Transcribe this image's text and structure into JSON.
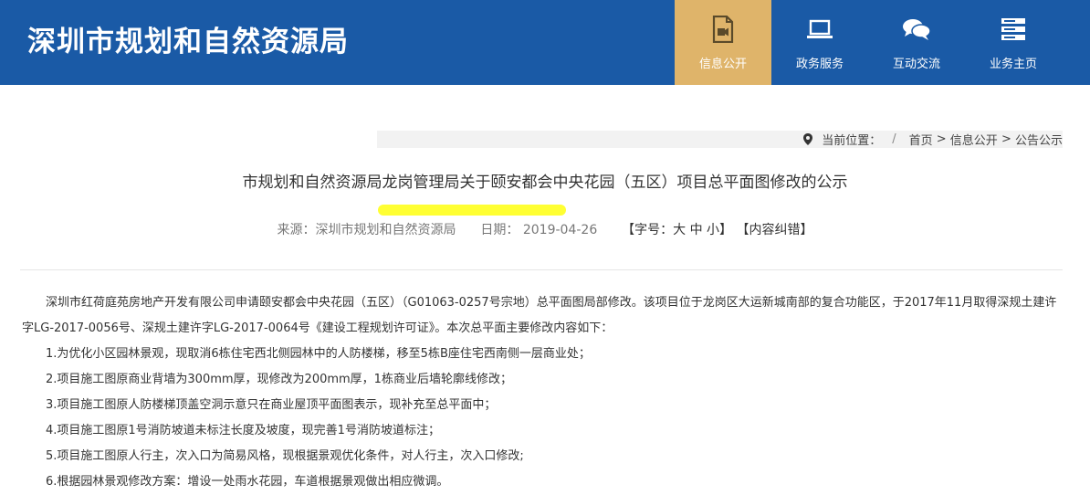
{
  "header": {
    "site_title": "深圳市规划和自然资源局",
    "nav": [
      {
        "label": "信息公开",
        "icon": "document-icon"
      },
      {
        "label": "政务服务",
        "icon": "laptop-icon"
      },
      {
        "label": "互动交流",
        "icon": "chat-icon"
      },
      {
        "label": "业务主页",
        "icon": "server-icon"
      }
    ],
    "colors": {
      "header_bg": "#1a5aa6",
      "active_nav_bg": "#dfb46a"
    }
  },
  "breadcrumb": {
    "prefix": "当前位置：",
    "separator": "/",
    "home": "首页",
    "arrow1": " > ",
    "level1": "信息公开",
    "arrow2": " > ",
    "level2": "公告公示"
  },
  "article": {
    "title": "市规划和自然资源局龙岗管理局关于颐安都会中央花园（五区）项目总平面图修改的公示",
    "source_label": "来源：",
    "source": "深圳市规划和自然资源局",
    "date_label": "日期：",
    "date": "2019-04-26",
    "font_open": "【字号：",
    "font_large": "大",
    "font_medium": "中",
    "font_small": "小",
    "font_close": "】",
    "correction": "【内容纠错】",
    "intro": "深圳市红荷庭苑房地产开发有限公司申请颐安都会中央花园（五区）（G01063-0257号宗地）总平面图局部修改。该项目位于龙岗区大运新城南部的复合功能区，于2017年11月取得深规土建许字LG-2017-0056号、深规土建许字LG-2017-0064号《建设工程规划许可证》。本次总平面主要修改内容如下：",
    "items": [
      "1.为优化小区园林景观，现取消6栋住宅西北侧园林中的人防楼梯，移至5栋B座住宅西南侧一层商业处；",
      "2.项目施工图原商业背墙为300mm厚，现修改为200mm厚，1栋商业后墙轮廓线修改；",
      "3.项目施工图原人防楼梯顶盖空洞示意只在商业屋顶平面图表示，现补充至总平面中；",
      "4.项目施工图原1号消防坡道未标注长度及坡度，现完善1号消防坡道标注；",
      "5.项目施工图原人行主，次入口为简易风格，现根据景观优化条件，对人行主，次入口修改;",
      "6.根据园林景观修改方案：增设一处雨水花园，车道根据景观做出相应微调。"
    ]
  }
}
